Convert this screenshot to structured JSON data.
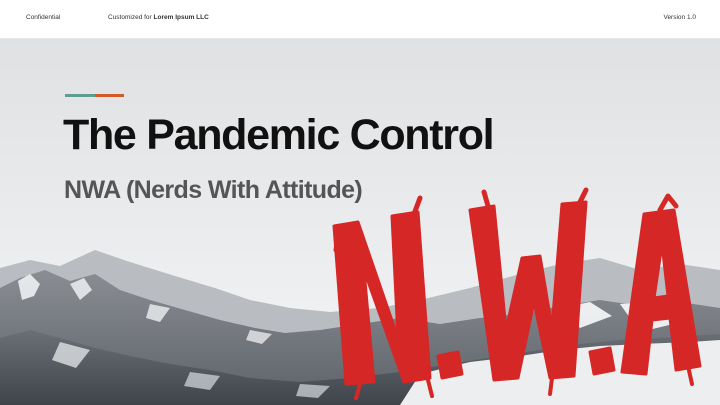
{
  "header": {
    "left_label": "Confidential",
    "customized_prefix": "Customized for",
    "customized_client": "Lorem Ipsum LLC",
    "version_label": "Version 1.0"
  },
  "slide": {
    "title": "The Pandemic Control",
    "subtitle": "NWA (Nerds With Attitude)",
    "accent_colors": [
      "#5e9e90",
      "#d05a28"
    ]
  },
  "logo": {
    "text": "N.W.A",
    "color": "#d62727"
  },
  "background": {
    "sky_top": "#dfe1e3",
    "sky_bottom": "#f4f5f6"
  }
}
